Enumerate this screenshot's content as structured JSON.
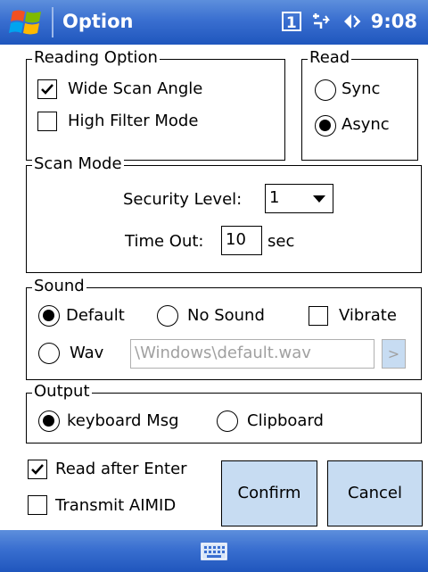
{
  "titlebar": {
    "title": "Option",
    "sim_indicator": "1",
    "time": "9:08",
    "icons": [
      "windows-start-icon",
      "sim-icon",
      "connectivity-icon",
      "volume-icon"
    ]
  },
  "reading_option": {
    "legend": "Reading Option",
    "wide_scan_angle": {
      "label": "Wide Scan Angle",
      "checked": true
    },
    "high_filter_mode": {
      "label": "High Filter Mode",
      "checked": false
    }
  },
  "read": {
    "legend": "Read",
    "sync": {
      "label": "Sync",
      "selected": false
    },
    "async": {
      "label": "Async",
      "selected": true
    }
  },
  "scan_mode": {
    "legend": "Scan Mode",
    "security_level_label": "Security Level:",
    "security_level_value": "1",
    "time_out_label": "Time Out:",
    "time_out_value": "10",
    "time_out_unit": "sec"
  },
  "sound": {
    "legend": "Sound",
    "default": {
      "label": "Default",
      "selected": true
    },
    "no_sound": {
      "label": "No Sound",
      "selected": false
    },
    "vibrate": {
      "label": "Vibrate",
      "checked": false
    },
    "wav": {
      "label": "Wav",
      "selected": false
    },
    "wav_path": "\\Windows\\default.wav",
    "browse_label": ">"
  },
  "output": {
    "legend": "Output",
    "keyboard_msg": {
      "label": "keyboard Msg",
      "selected": true
    },
    "clipboard": {
      "label": "Clipboard",
      "selected": false
    }
  },
  "options": {
    "read_after_enter": {
      "label": "Read after Enter",
      "checked": true
    },
    "transmit_aimid": {
      "label": "Transmit AIMID",
      "checked": false
    }
  },
  "buttons": {
    "confirm": "Confirm",
    "cancel": "Cancel"
  },
  "colors": {
    "titlebar": "#3a6fd0",
    "button_bg": "#c7dcf2"
  }
}
